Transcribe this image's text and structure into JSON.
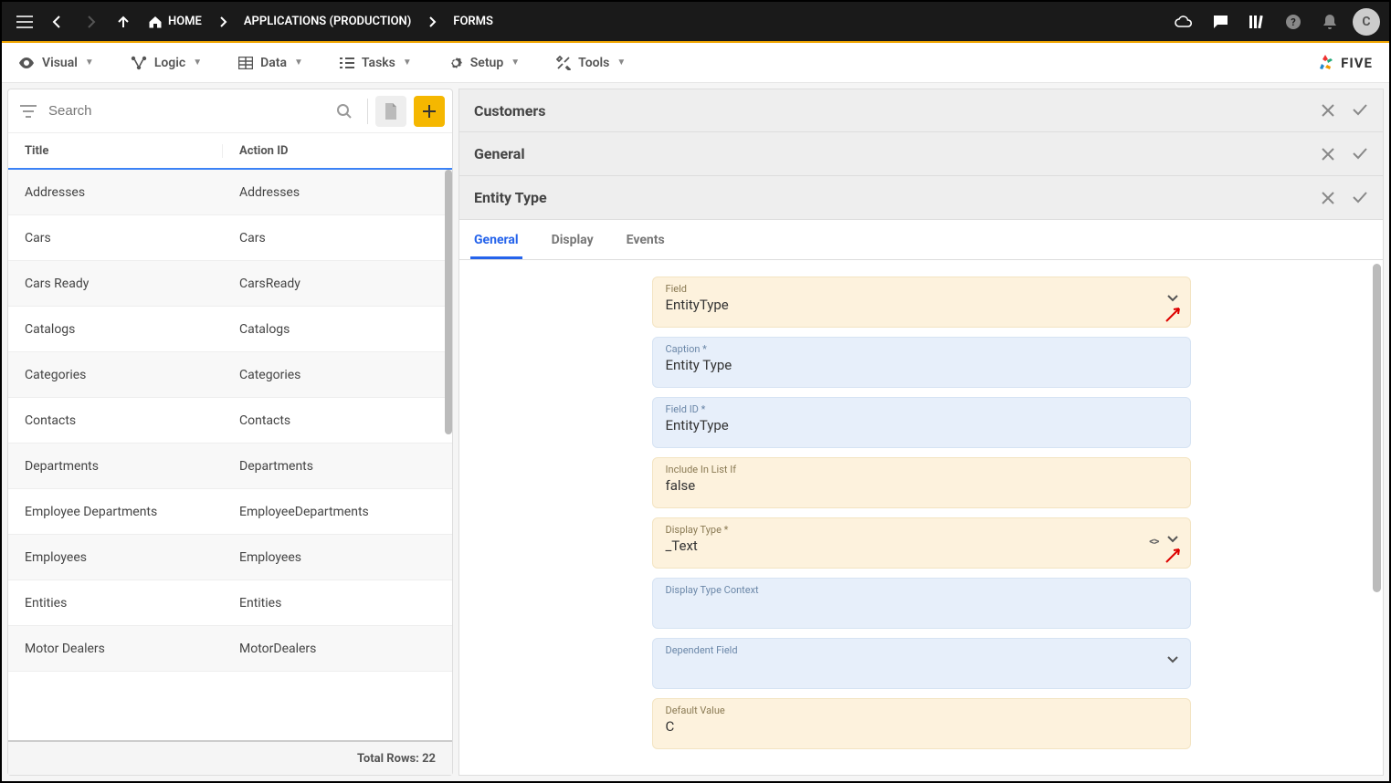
{
  "breadcrumbs": {
    "home": "HOME",
    "apps": "APPLICATIONS (PRODUCTION)",
    "forms": "FORMS"
  },
  "avatar_initial": "C",
  "menu": {
    "visual": "Visual",
    "logic": "Logic",
    "data": "Data",
    "tasks": "Tasks",
    "setup": "Setup",
    "tools": "Tools"
  },
  "brand": "FIVE",
  "left": {
    "search_placeholder": "Search",
    "columns": {
      "title": "Title",
      "action": "Action ID"
    },
    "rows": [
      {
        "title": "Addresses",
        "action": "Addresses"
      },
      {
        "title": "Cars",
        "action": "Cars"
      },
      {
        "title": "Cars Ready",
        "action": "CarsReady"
      },
      {
        "title": "Catalogs",
        "action": "Catalogs"
      },
      {
        "title": "Categories",
        "action": "Categories"
      },
      {
        "title": "Contacts",
        "action": "Contacts"
      },
      {
        "title": "Departments",
        "action": "Departments"
      },
      {
        "title": "Employee Departments",
        "action": "EmployeeDepartments"
      },
      {
        "title": "Employees",
        "action": "Employees"
      },
      {
        "title": "Entities",
        "action": "Entities"
      },
      {
        "title": "Motor Dealers",
        "action": "MotorDealers"
      }
    ],
    "footer_label": "Total Rows: 22"
  },
  "right": {
    "section1": "Customers",
    "section2": "General",
    "section3": "Entity Type",
    "tabs": {
      "general": "General",
      "display": "Display",
      "events": "Events"
    },
    "fields": {
      "field": {
        "label": "Field",
        "value": "EntityType"
      },
      "caption": {
        "label": "Caption *",
        "value": "Entity Type"
      },
      "fieldid": {
        "label": "Field ID *",
        "value": "EntityType"
      },
      "include": {
        "label": "Include In List If",
        "value": "false"
      },
      "displaytype": {
        "label": "Display Type *",
        "value": "_Text"
      },
      "displayctx": {
        "label": "Display Type Context",
        "value": ""
      },
      "dependent": {
        "label": "Dependent Field",
        "value": ""
      },
      "default": {
        "label": "Default Value",
        "value": "C"
      }
    }
  }
}
